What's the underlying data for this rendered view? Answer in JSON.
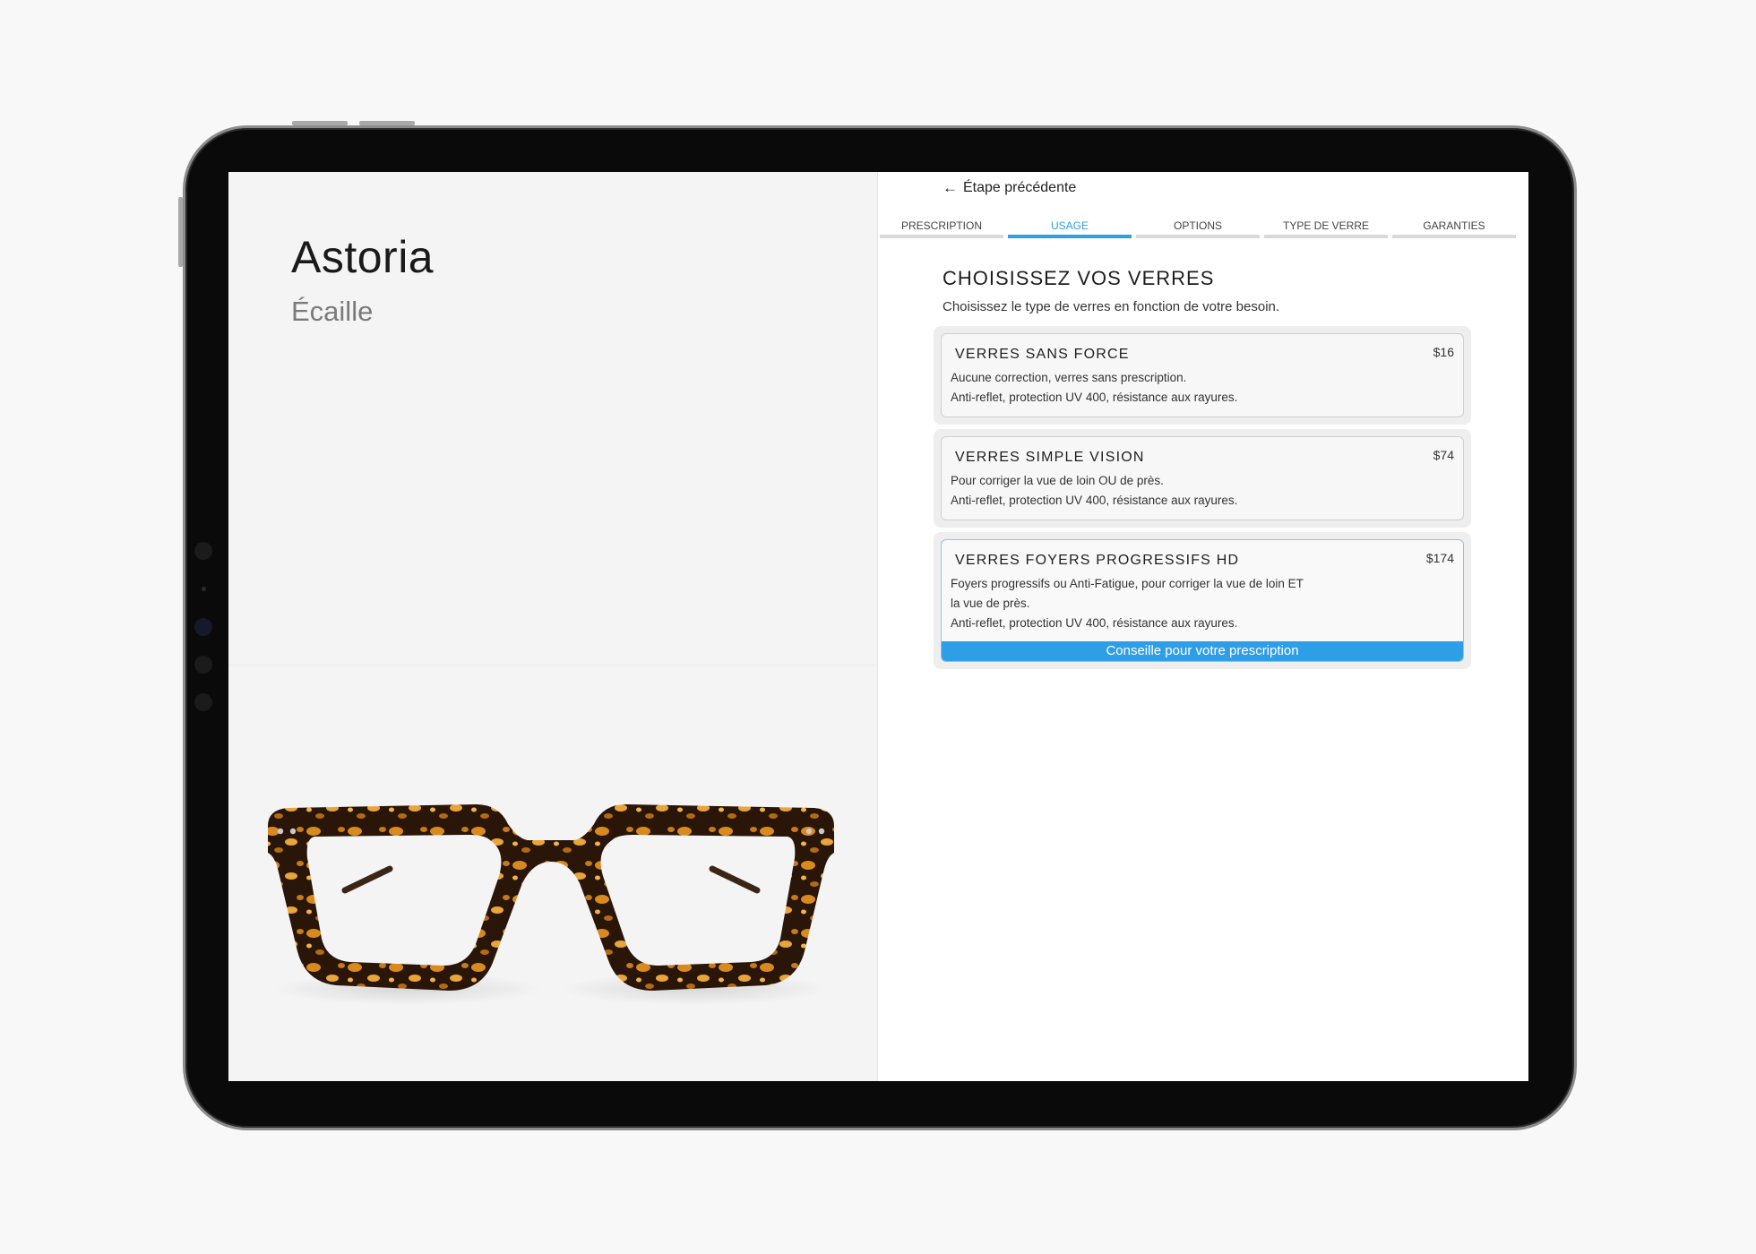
{
  "product": {
    "name": "Astoria",
    "color": "Écaille"
  },
  "nav": {
    "back_label": "Étape précédente",
    "tabs": [
      {
        "label": "PRESCRIPTION",
        "active": false
      },
      {
        "label": "USAGE",
        "active": true
      },
      {
        "label": "OPTIONS",
        "active": false
      },
      {
        "label": "TYPE DE VERRE",
        "active": false
      },
      {
        "label": "GARANTIES",
        "active": false
      }
    ]
  },
  "section": {
    "title": "CHOISISSEZ VOS VERRES",
    "subtitle": "Choisissez le type de verres en fonction de votre besoin."
  },
  "lenses": [
    {
      "title": "VERRES SANS FORCE",
      "price": "$16",
      "desc": [
        "Aucune correction, verres sans prescription.",
        "Anti-reflet, protection UV 400, résistance aux rayures."
      ]
    },
    {
      "title": "VERRES SIMPLE VISION",
      "price": "$74",
      "desc": [
        "Pour corriger la vue de loin OU de près.",
        "Anti-reflet, protection UV 400, résistance aux rayures."
      ]
    },
    {
      "title": "VERRES FOYERS PROGRESSIFS HD",
      "price": "$174",
      "desc": [
        "Foyers progressifs ou Anti-Fatigue, pour corriger la vue de loin ET",
        "la vue de près.",
        "Anti-reflet, protection UV 400, résistance aux rayures."
      ],
      "cta": "Conseille pour votre prescription"
    }
  ],
  "colors": {
    "accent": "#2e9ee6",
    "frame_dark": "#2a1608",
    "frame_amber": "#d88a1e"
  }
}
